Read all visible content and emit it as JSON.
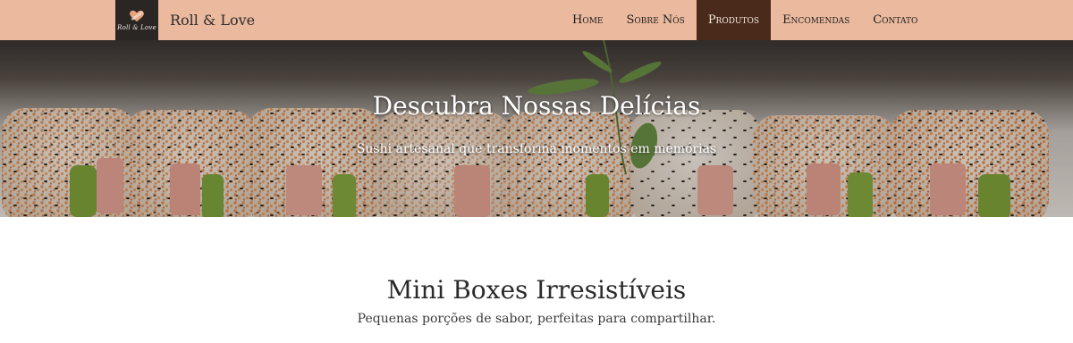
{
  "brand": {
    "logo_text": "Roll & Love",
    "name": "Roll & Love"
  },
  "nav": {
    "items": [
      {
        "label": "Home",
        "active": false
      },
      {
        "label": "Sobre Nós",
        "active": false
      },
      {
        "label": "Produtos",
        "active": true
      },
      {
        "label": "Encomendas",
        "active": false
      },
      {
        "label": "Contato",
        "active": false
      }
    ]
  },
  "hero": {
    "title": "Descubra Nossas Delícias",
    "subtitle": "Sushi artesanal que transforma momentos em memórias",
    "image": "sushi-rolls-photo"
  },
  "section": {
    "title": "Mini Boxes Irresistíveis",
    "subtitle": "Pequenas porções de sabor, perfeitas para compartilhar."
  },
  "colors": {
    "navbar_bg": "#ebb99e",
    "nav_active_bg": "#4a2a1b",
    "logo_bg": "#2a2624",
    "text": "#2b2b2b"
  }
}
